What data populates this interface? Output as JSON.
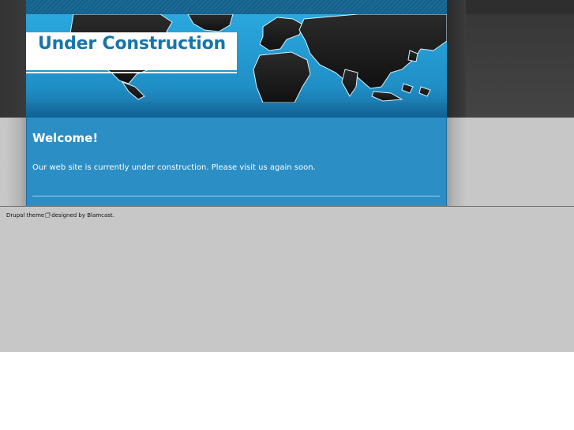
{
  "header": {
    "site_name": "Under Construction"
  },
  "content": {
    "title": "Welcome!",
    "body": "Our web site is currently under construction. Please visit us again soon."
  },
  "footer": {
    "prefix": "Drupal theme",
    "designed_by": "designed by Blamcast",
    "suffix": "."
  },
  "colors": {
    "header_blue": "#2aa8de",
    "content_blue": "#2b8ec5",
    "site_name": "#1775aa",
    "page_background": "#c7c7c7",
    "top_band": "#3f3f3f"
  },
  "icons": {
    "external_link": "external-link-icon",
    "world_map": "world-map-graphic"
  }
}
